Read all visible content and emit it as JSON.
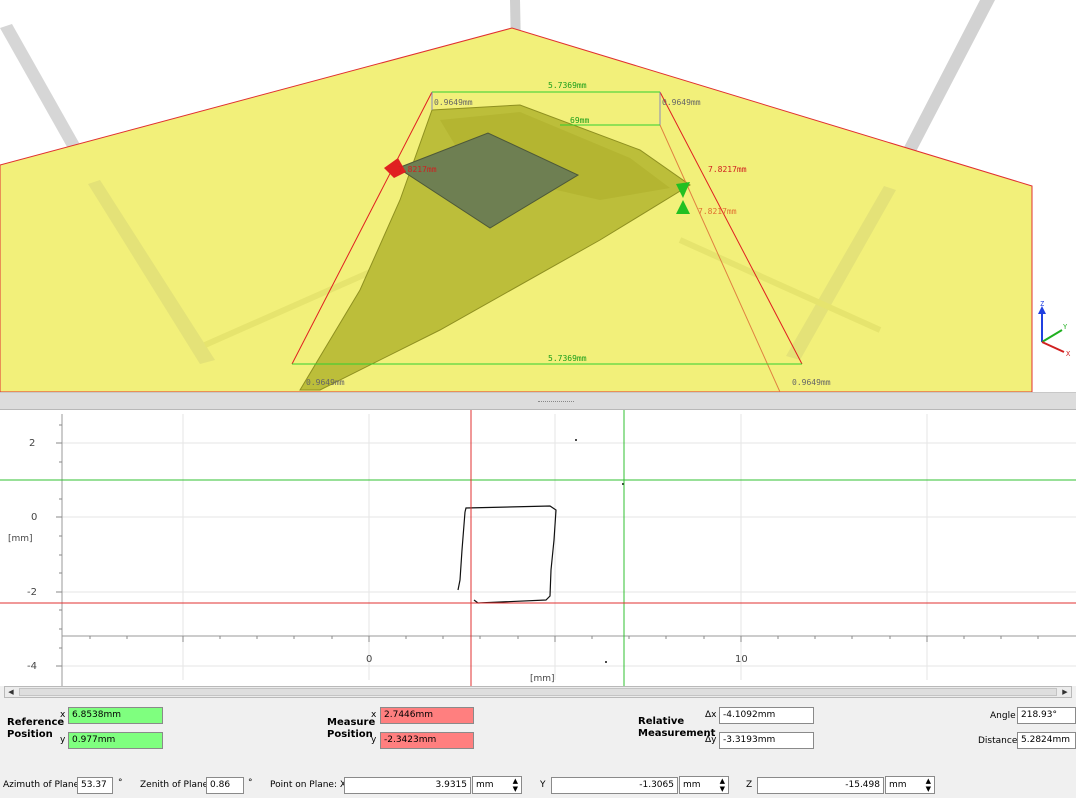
{
  "view3d": {
    "labels": {
      "top_width": "5.7369mm",
      "bottom_width": "5.7369mm",
      "top_left_depth": "0.9649mm",
      "top_right_depth": "0.9649mm",
      "bottom_left_depth": "0.9649mm",
      "bottom_right_depth": "0.9649mm",
      "right_length": "7.8217mm",
      "right_length_2": "7.8217mm",
      "left_marker_value": "7.8217mm",
      "partial_top": "69mm"
    },
    "axis": {
      "z": "Z",
      "y": "Y",
      "x": "X"
    },
    "colors": {
      "plane": "#f2f07a",
      "object": "#bdbf3a",
      "ref": "#e02020",
      "measure": "#20c020"
    }
  },
  "plot2d": {
    "y_ticks": [
      "2",
      "0",
      "-2",
      "-4"
    ],
    "x_ticks": [
      "0",
      "10"
    ],
    "y_unit": "[mm]",
    "x_unit": "[mm]"
  },
  "reference": {
    "label_line1": "Reference",
    "label_line2": "Position",
    "x_label": "x",
    "y_label": "y",
    "x_value": "6.8538mm",
    "y_value": "0.977mm"
  },
  "measure": {
    "label_line1": "Measure",
    "label_line2": "Position",
    "x_label": "x",
    "y_label": "y",
    "x_value": "2.7446mm",
    "y_value": "-2.3423mm"
  },
  "relative": {
    "label_line1": "Relative",
    "label_line2": "Measurement",
    "dx_label": "Δx",
    "dy_label": "Δy",
    "dx_value": "-4.1092mm",
    "dy_value": "-3.3193mm"
  },
  "angle": {
    "label": "Angle",
    "value": "218.93°"
  },
  "distance": {
    "label": "Distance",
    "value": "5.2824mm"
  },
  "plane": {
    "azimuth_label": "Azimuth of Plane",
    "azimuth_value": "53.37",
    "zenith_label": "Zenith of Plane",
    "zenith_value": "0.86",
    "degree": "°",
    "point_label": "Point on Plane: X",
    "x_value": "3.9315",
    "y_label": "Y",
    "y_value": "-1.3065",
    "z_label": "Z",
    "z_value": "-15.498",
    "unit": "mm"
  }
}
